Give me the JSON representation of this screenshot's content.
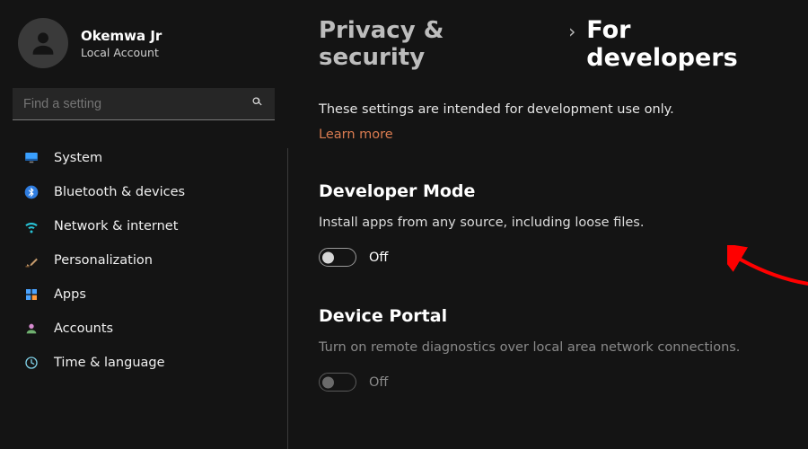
{
  "user": {
    "name": "Okemwa Jr",
    "account_type": "Local Account"
  },
  "search": {
    "placeholder": "Find a setting"
  },
  "nav": {
    "items": [
      {
        "key": "system",
        "label": "System"
      },
      {
        "key": "bluetooth",
        "label": "Bluetooth & devices"
      },
      {
        "key": "network",
        "label": "Network & internet"
      },
      {
        "key": "personal",
        "label": "Personalization"
      },
      {
        "key": "apps",
        "label": "Apps"
      },
      {
        "key": "accounts",
        "label": "Accounts"
      },
      {
        "key": "time",
        "label": "Time & language"
      }
    ]
  },
  "breadcrumb": {
    "parent": "Privacy & security",
    "separator": "›",
    "current": "For developers"
  },
  "page": {
    "intro": "These settings are intended for development use only.",
    "learn_more": "Learn more",
    "dev_mode": {
      "title": "Developer Mode",
      "desc": "Install apps from any source, including loose files.",
      "state_label": "Off",
      "enabled": true
    },
    "device_portal": {
      "title": "Device Portal",
      "desc": "Turn on remote diagnostics over local area network connections.",
      "state_label": "Off",
      "enabled": false
    }
  },
  "colors": {
    "accent_link": "#d97b50",
    "arrow": "#ff0000"
  }
}
